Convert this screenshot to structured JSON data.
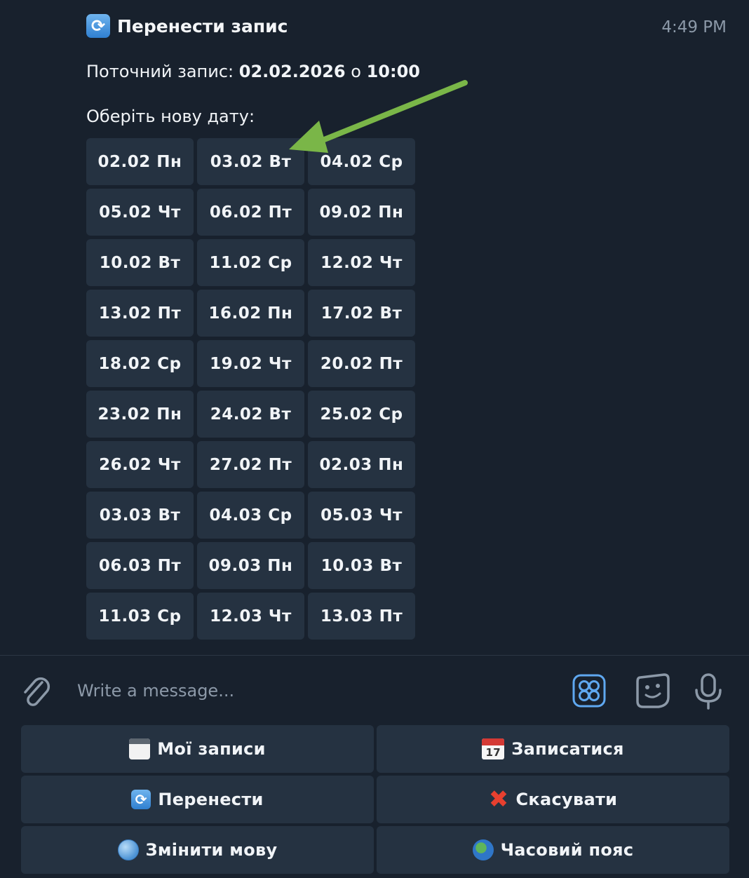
{
  "message": {
    "icon": "refresh-icon",
    "title": "Перенести запис",
    "time": "4:49 PM",
    "current_label": "Поточний запис:",
    "current_date": "02.02.2026",
    "current_sep": "о",
    "current_time": "10:00",
    "prompt": "Оберіть нову дату:"
  },
  "dates": [
    "02.02 Пн",
    "03.02 Вт",
    "04.02 Ср",
    "05.02 Чт",
    "06.02 Пт",
    "09.02 Пн",
    "10.02 Вт",
    "11.02 Ср",
    "12.02 Чт",
    "13.02 Пт",
    "16.02 Пн",
    "17.02 Вт",
    "18.02 Ср",
    "19.02 Чт",
    "20.02 Пт",
    "23.02 Пн",
    "24.02 Вт",
    "25.02 Ср",
    "26.02 Чт",
    "27.02 Пт",
    "02.03 Пн",
    "03.03 Вт",
    "04.03 Ср",
    "05.03 Чт",
    "06.03 Пт",
    "09.03 Пн",
    "10.03 Вт",
    "11.03 Ср",
    "12.03 Чт",
    "13.03 Пт"
  ],
  "annotation": {
    "arrow_color": "#7ab648",
    "points_to": "03.02 Вт"
  },
  "input": {
    "placeholder": "Write a message..."
  },
  "keyboard": [
    {
      "icon": "calendar-icon",
      "label": "Мої записи"
    },
    {
      "icon": "calendar-17-icon",
      "label": "Записатися",
      "day": "17"
    },
    {
      "icon": "refresh-icon",
      "label": "Перенести"
    },
    {
      "icon": "cross-icon",
      "label": "Скасувати",
      "glyph": "✖"
    },
    {
      "icon": "globe-icon",
      "label": "Змінити мову"
    },
    {
      "icon": "earth-icon",
      "label": "Часовий пояс"
    }
  ],
  "colors": {
    "background": "#18212d",
    "button": "#253241",
    "accent_blue": "#5fa8f0",
    "arrow_green": "#7ab648"
  }
}
